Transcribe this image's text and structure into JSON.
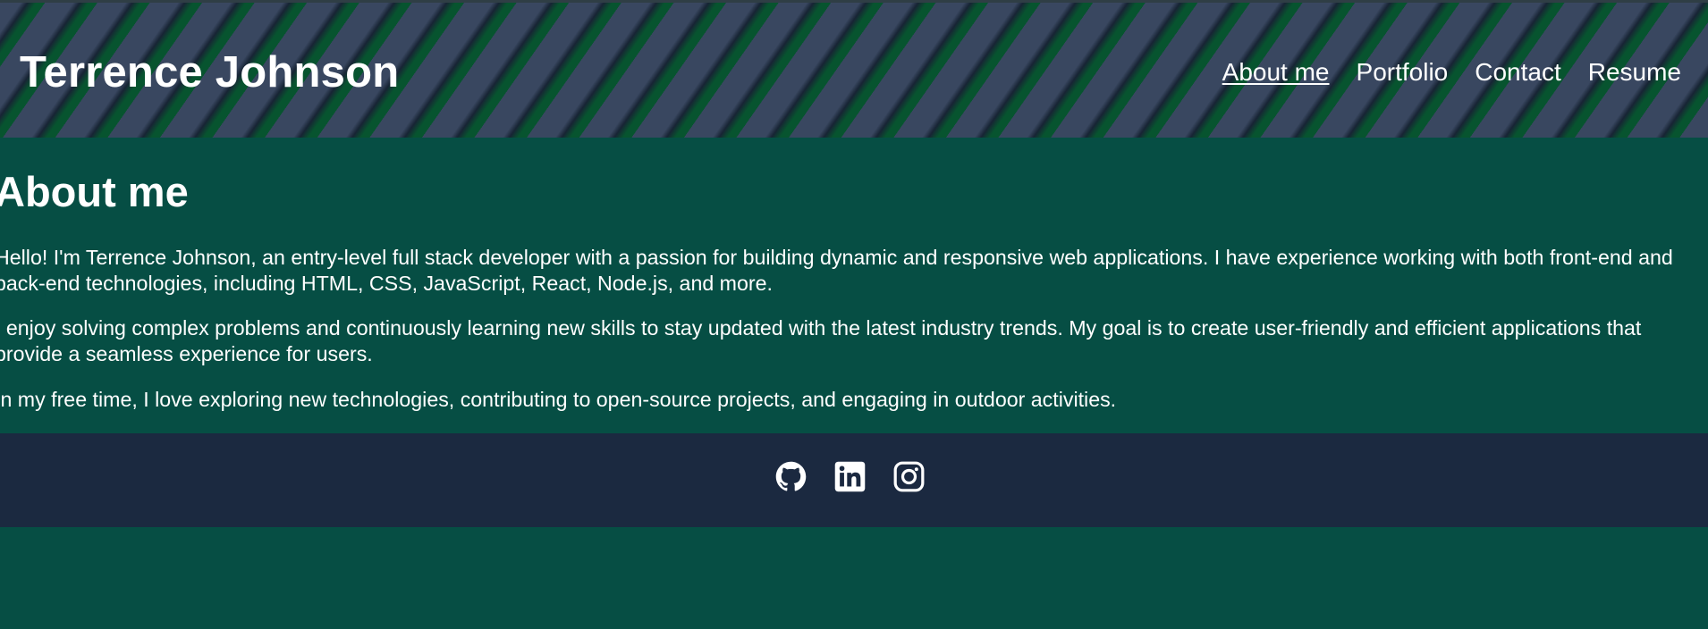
{
  "header": {
    "title": "Terrence Johnson",
    "nav": [
      "About me",
      "Portfolio",
      "Contact",
      "Resume"
    ],
    "active_nav": "About me"
  },
  "main": {
    "heading": "About me",
    "paragraphs": [
      "Hello! I'm Terrence Johnson, an entry-level full stack developer with a passion for building dynamic and responsive web applications. I have experience working with both front-end and back-end technologies, including HTML, CSS, JavaScript, React, Node.js, and more.",
      "I enjoy solving complex problems and continuously learning new skills to stay updated with the latest industry trends. My goal is to create user-friendly and efficient applications that provide a seamless experience for users.",
      "In my free time, I love exploring new technologies, contributing to open-source projects, and engaging in outdoor activities."
    ]
  },
  "footer": {
    "social_icons": [
      "github-icon",
      "linkedin-icon",
      "instagram-icon"
    ]
  },
  "colors": {
    "body_bg": "#064e44",
    "footer_bg": "#1b2940",
    "header_stripe": "#394760",
    "text": "#ffffff"
  }
}
